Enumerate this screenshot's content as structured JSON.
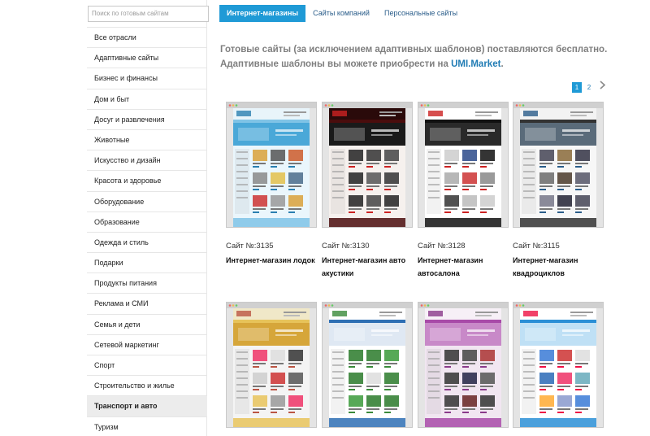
{
  "search": {
    "placeholder": "Поиск по готовым сайтам"
  },
  "categories": [
    "Все отрасли",
    "Адаптивные сайты",
    "Бизнес и финансы",
    "Дом и быт",
    "Досуг и развлечения",
    "Животные",
    "Искусство и дизайн",
    "Красота и здоровье",
    "Оборудование",
    "Образование",
    "Одежда и стиль",
    "Подарки",
    "Продукты питания",
    "Реклама и СМИ",
    "Семья и дети",
    "Сетевой маркетинг",
    "Спорт",
    "Строительство и жилье",
    "Транспорт и авто",
    "Туризм"
  ],
  "active_category": "Транспорт и авто",
  "tabs": [
    {
      "label": "Интернет-магазины",
      "active": true
    },
    {
      "label": "Сайты компаний",
      "active": false
    },
    {
      "label": "Персональные сайты",
      "active": false
    }
  ],
  "info": {
    "line1": "Готовые сайты (за исключением адаптивных шаблонов) поставляются бесплатно.",
    "line2_prefix": "Адаптивные шаблоны вы можете приобрести на ",
    "link": "UMI.Market",
    "line2_suffix": "."
  },
  "pagination": {
    "pages": [
      "1",
      "2"
    ],
    "current": "1"
  },
  "templates": [
    {
      "id": "Сайт №:3135",
      "title": "Интернет-магазин лодок",
      "theme": "boats"
    },
    {
      "id": "Сайт №:3130",
      "title": "Интернет-магазин авто акустики",
      "theme": "audio"
    },
    {
      "id": "Сайт №:3128",
      "title": "Интернет-магазин автосалона",
      "theme": "autosalon"
    },
    {
      "id": "Сайт №:3115",
      "title": "Интернет-магазин квадроциклов",
      "theme": "atv"
    },
    {
      "id": "",
      "title": "",
      "theme": "accessories"
    },
    {
      "id": "",
      "title": "",
      "theme": "parts"
    },
    {
      "id": "",
      "title": "",
      "theme": "childseats"
    },
    {
      "id": "",
      "title": "",
      "theme": "autochem"
    }
  ],
  "colors": {
    "accent": "#1f9ad6",
    "link": "#1f7bb4",
    "muted_text": "#7f7f7f"
  }
}
